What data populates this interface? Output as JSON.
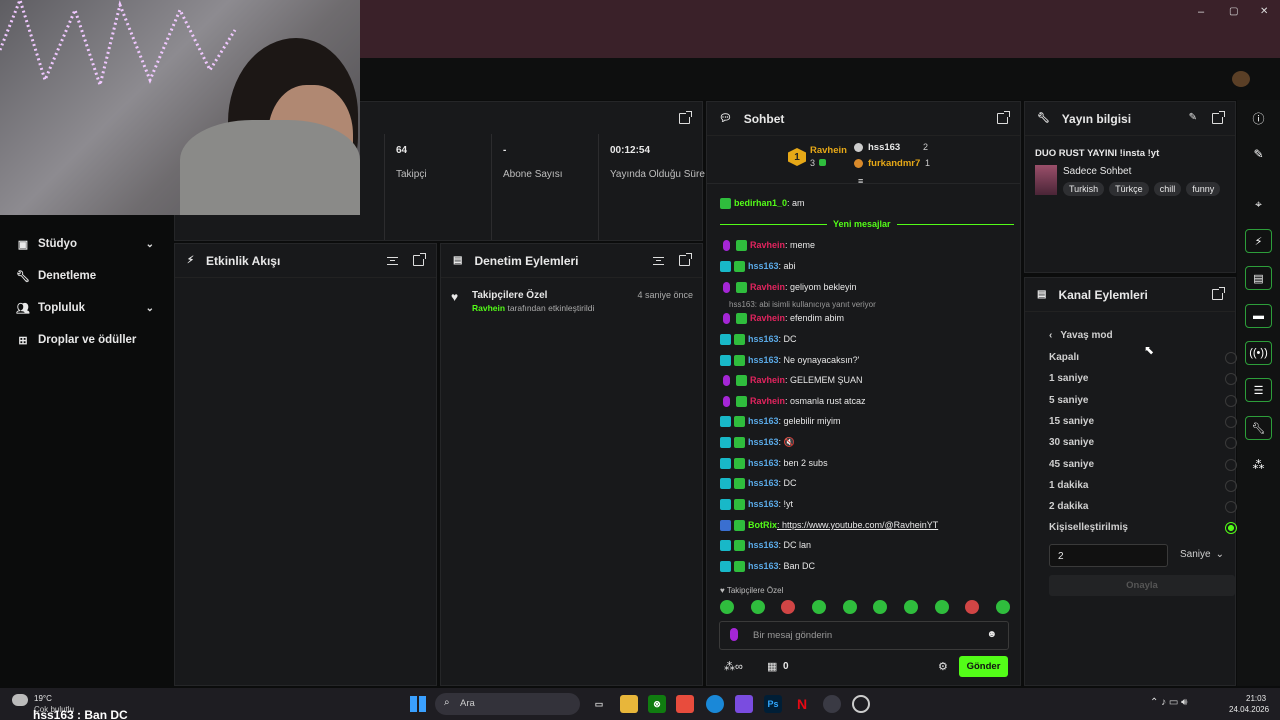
{
  "browser": {
    "title_controls": [
      "–",
      "▢",
      "✕"
    ]
  },
  "sidebar": {
    "items": [
      {
        "label": "Stüdyo",
        "icon": "film-icon",
        "chevron": true
      },
      {
        "label": "Denetleme",
        "icon": "wrench-icon",
        "chevron": false
      },
      {
        "label": "Topluluk",
        "icon": "people-icon",
        "chevron": true
      },
      {
        "label": "Droplar ve ödüller",
        "icon": "gift-icon",
        "chevron": false
      }
    ]
  },
  "stats": [
    {
      "value": "64",
      "label": "Takipçi"
    },
    {
      "value": "-",
      "label": "Abone Sayısı"
    },
    {
      "value": "00:12:54",
      "label": "Yayında Olduğu Süre"
    }
  ],
  "activity_feed": {
    "title": "Etkinlik Akışı"
  },
  "mod_actions": {
    "title": "Denetim Eylemleri",
    "entry": {
      "title": "Takipçilere Özel",
      "time": "4 saniye önce",
      "actor": "Ravhein",
      "detail": "tarafından etkinleştirildi"
    }
  },
  "chat": {
    "title": "Sohbet",
    "leaderboard": {
      "first": {
        "rank": "1",
        "name": "Ravhein",
        "count": "3"
      },
      "second": {
        "name": "hss163",
        "count": "2"
      },
      "third": {
        "name": "furkandmr7",
        "count": "1"
      }
    },
    "first_msg": {
      "user": "bedirhan1_0",
      "text": ": am"
    },
    "new_messages": "Yeni mesajlar",
    "reply_note": "hss163: abi isimli kullanıcıya yanıt veriyor",
    "messages": [
      {
        "user": "Ravhein",
        "color": "#e0245e",
        "kind": "mic",
        "text": ": meme"
      },
      {
        "user": "hss163",
        "color": "#5aa9e6",
        "kind": "grid",
        "text": ": abi"
      },
      {
        "user": "Ravhein",
        "color": "#e0245e",
        "kind": "mic",
        "text": ": geliyom bekleyin"
      },
      {
        "user": "Ravhein",
        "color": "#e0245e",
        "kind": "mic",
        "text": ": efendim abim"
      },
      {
        "user": "hss163",
        "color": "#5aa9e6",
        "kind": "grid",
        "text": ": DC"
      },
      {
        "user": "hss163",
        "color": "#5aa9e6",
        "kind": "grid",
        "text": ": Ne oynayacaksın?'"
      },
      {
        "user": "Ravhein",
        "color": "#e0245e",
        "kind": "mic",
        "text": ": GELEMEM ŞUAN"
      },
      {
        "user": "Ravhein",
        "color": "#e0245e",
        "kind": "mic",
        "text": ": osmanla rust atcaz"
      },
      {
        "user": "hss163",
        "color": "#5aa9e6",
        "kind": "grid",
        "text": ": gelebilir miyim"
      },
      {
        "user": "hss163",
        "color": "#5aa9e6",
        "kind": "grid",
        "text": ": 🔇"
      },
      {
        "user": "hss163",
        "color": "#5aa9e6",
        "kind": "grid",
        "text": ": ben 2 subs"
      },
      {
        "user": "hss163",
        "color": "#5aa9e6",
        "kind": "grid",
        "text": ": DC"
      },
      {
        "user": "hss163",
        "color": "#5aa9e6",
        "kind": "grid",
        "text": ": !yt"
      },
      {
        "user": "BotRix",
        "color": "#53fc18",
        "kind": "bot",
        "text": ": https://www.youtube.com/@RavheinYT"
      },
      {
        "user": "hss163",
        "color": "#5aa9e6",
        "kind": "grid",
        "text": ": DC lan"
      },
      {
        "user": "hss163",
        "color": "#5aa9e6",
        "kind": "grid",
        "text": ": Ban DC"
      }
    ],
    "followers_only": "Takipçilere Özel",
    "input_placeholder": "Bir mesaj gönderin",
    "bottom_count": "0",
    "send": "Gönder"
  },
  "stream_info": {
    "title": "Yayın bilgisi",
    "stream_title": "DUO RUST YAYINI !insta !yt",
    "category": "Sadece Sohbet",
    "tags": [
      "Turkish",
      "Türkçe",
      "chill",
      "funny"
    ]
  },
  "channel_actions": {
    "title": "Kanal Eylemleri",
    "back": "Yavaş mod",
    "options": [
      "Kapalı",
      "1 saniye",
      "5 saniye",
      "15 saniye",
      "30 saniye",
      "45 saniye",
      "1 dakika",
      "2 dakika",
      "Kişiselleştirilmiş"
    ],
    "selected": 8,
    "custom_value": "2",
    "unit": "Saniye",
    "confirm": "Onayla"
  },
  "taskbar": {
    "weather_temp": "19°C",
    "weather_desc": "Çok bulutlu",
    "search": "Ara",
    "time": "21:03",
    "date": "24.04.2026",
    "overlay": "hss163 : Ban DC"
  },
  "colors": {
    "accent": "#53fc18",
    "mention": "#e0245e",
    "user": "#5aa9e6"
  }
}
